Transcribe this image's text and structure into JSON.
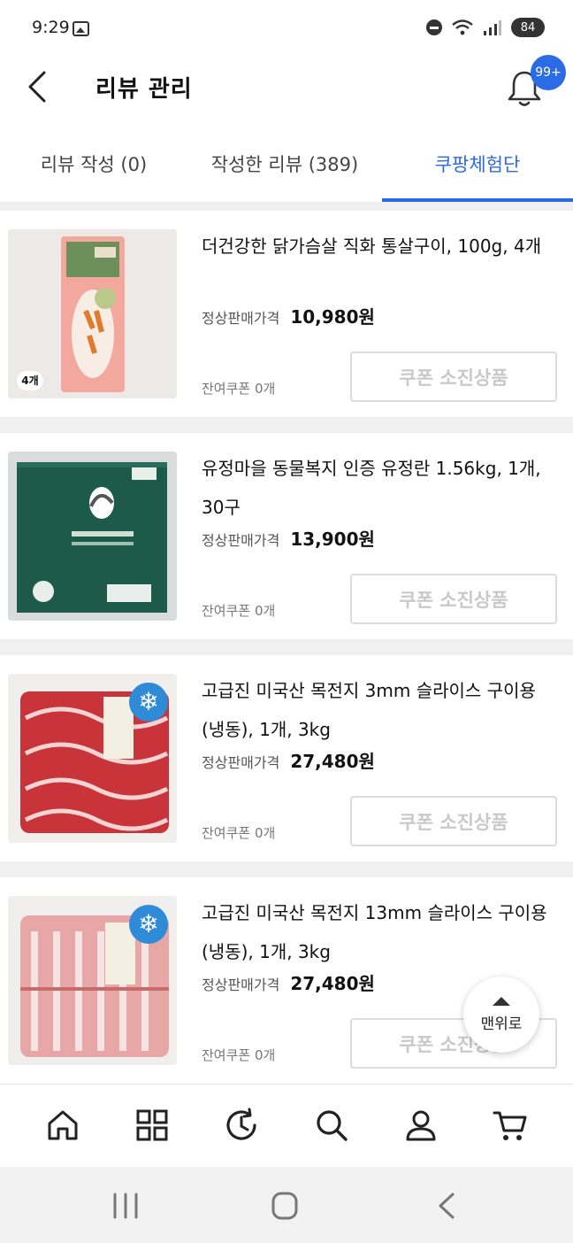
{
  "status_bar": {
    "time": "9:29",
    "battery": "84"
  },
  "header": {
    "title": "리뷰 관리",
    "notification_badge": "99+"
  },
  "tabs": [
    {
      "label": "리뷰 작성 (0)"
    },
    {
      "label": "작성한 리뷰 (389)"
    },
    {
      "label": "쿠팡체험단"
    }
  ],
  "products": [
    {
      "name": "더건강한 닭가슴살 직화 통살구이, 100g, 4개",
      "price_label": "정상판매가격",
      "price": "10,980원",
      "coupon_left": "잔여쿠폰 0개",
      "coupon_button": "쿠폰 소진상품",
      "image_badge": "4개"
    },
    {
      "name": "유정마을 동물복지 인증 유정란 1.56kg, 1개, 30구",
      "price_label": "정상판매가격",
      "price": "13,900원",
      "coupon_left": "잔여쿠폰 0개",
      "coupon_button": "쿠폰 소진상품"
    },
    {
      "name": "고급진 미국산 목전지 3mm 슬라이스 구이용 (냉동), 1개, 3kg",
      "price_label": "정상판매가격",
      "price": "27,480원",
      "coupon_left": "잔여쿠폰 0개",
      "coupon_button": "쿠폰 소진상품"
    },
    {
      "name": "고급진 미국산 목전지 13mm 슬라이스 구이용 (냉동), 1개, 3kg",
      "price_label": "정상판매가격",
      "price": "27,480원",
      "coupon_left": "잔여쿠폰 0개",
      "coupon_button": "쿠폰 소진상품"
    }
  ],
  "scroll_top": {
    "label": "맨위로"
  },
  "bottom_nav": [
    {
      "icon": "home-icon"
    },
    {
      "icon": "category-icon"
    },
    {
      "icon": "recent-icon"
    },
    {
      "icon": "search-icon"
    },
    {
      "icon": "my-page-icon"
    },
    {
      "icon": "cart-icon"
    }
  ],
  "colors": {
    "accent": "#2b6be6",
    "badge": "#2b6be6",
    "disabled_text": "#c9c9c9"
  }
}
